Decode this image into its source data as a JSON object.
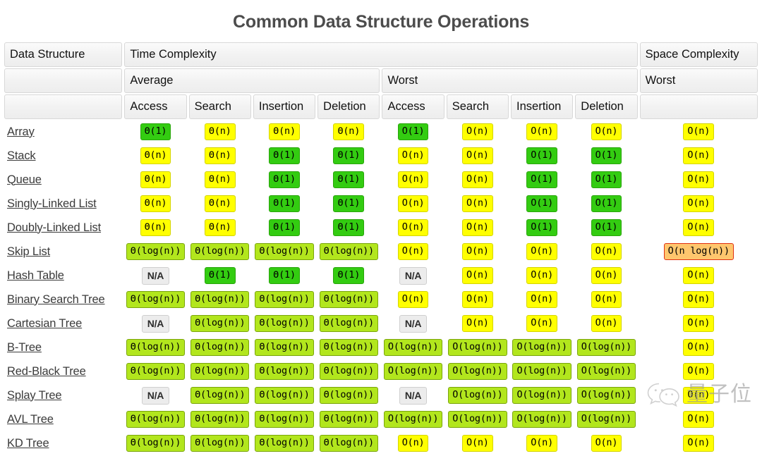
{
  "title": "Common Data Structure Operations",
  "colors": {
    "constant": "#33cc11",
    "logarithmic": "#b2e61d",
    "linear": "#ffff00",
    "linearithmic": "#ffc66d",
    "na": "#ececec",
    "title": "#4c4c4c"
  },
  "header": {
    "row1": {
      "data_structure": "Data Structure",
      "time_complexity": "Time Complexity",
      "space_complexity": "Space Complexity"
    },
    "row2": {
      "blank": "",
      "average": "Average",
      "worst": "Worst",
      "space_worst": "Worst"
    },
    "row3": {
      "blank": "",
      "avg_access": "Access",
      "avg_search": "Search",
      "avg_insertion": "Insertion",
      "avg_deletion": "Deletion",
      "worst_access": "Access",
      "worst_search": "Search",
      "worst_insertion": "Insertion",
      "worst_deletion": "Deletion",
      "space_blank": ""
    }
  },
  "chart_data": {
    "type": "table",
    "title": "Common Data Structure Operations",
    "columns": [
      "Data Structure",
      "Average Access",
      "Average Search",
      "Average Insertion",
      "Average Deletion",
      "Worst Access",
      "Worst Search",
      "Worst Insertion",
      "Worst Deletion",
      "Worst Space"
    ],
    "rows": [
      {
        "name": "Array",
        "cells": [
          {
            "t": "Θ(1)",
            "c": "green"
          },
          {
            "t": "Θ(n)",
            "c": "yellow"
          },
          {
            "t": "Θ(n)",
            "c": "yellow"
          },
          {
            "t": "Θ(n)",
            "c": "yellow"
          },
          {
            "t": "O(1)",
            "c": "green"
          },
          {
            "t": "O(n)",
            "c": "yellow"
          },
          {
            "t": "O(n)",
            "c": "yellow"
          },
          {
            "t": "O(n)",
            "c": "yellow"
          },
          {
            "t": "O(n)",
            "c": "yellow"
          }
        ]
      },
      {
        "name": "Stack",
        "cells": [
          {
            "t": "Θ(n)",
            "c": "yellow"
          },
          {
            "t": "Θ(n)",
            "c": "yellow"
          },
          {
            "t": "Θ(1)",
            "c": "green"
          },
          {
            "t": "Θ(1)",
            "c": "green"
          },
          {
            "t": "O(n)",
            "c": "yellow"
          },
          {
            "t": "O(n)",
            "c": "yellow"
          },
          {
            "t": "O(1)",
            "c": "green"
          },
          {
            "t": "O(1)",
            "c": "green"
          },
          {
            "t": "O(n)",
            "c": "yellow"
          }
        ]
      },
      {
        "name": "Queue",
        "cells": [
          {
            "t": "Θ(n)",
            "c": "yellow"
          },
          {
            "t": "Θ(n)",
            "c": "yellow"
          },
          {
            "t": "Θ(1)",
            "c": "green"
          },
          {
            "t": "Θ(1)",
            "c": "green"
          },
          {
            "t": "O(n)",
            "c": "yellow"
          },
          {
            "t": "O(n)",
            "c": "yellow"
          },
          {
            "t": "O(1)",
            "c": "green"
          },
          {
            "t": "O(1)",
            "c": "green"
          },
          {
            "t": "O(n)",
            "c": "yellow"
          }
        ]
      },
      {
        "name": "Singly-Linked List",
        "cells": [
          {
            "t": "Θ(n)",
            "c": "yellow"
          },
          {
            "t": "Θ(n)",
            "c": "yellow"
          },
          {
            "t": "Θ(1)",
            "c": "green"
          },
          {
            "t": "Θ(1)",
            "c": "green"
          },
          {
            "t": "O(n)",
            "c": "yellow"
          },
          {
            "t": "O(n)",
            "c": "yellow"
          },
          {
            "t": "O(1)",
            "c": "green"
          },
          {
            "t": "O(1)",
            "c": "green"
          },
          {
            "t": "O(n)",
            "c": "yellow"
          }
        ]
      },
      {
        "name": "Doubly-Linked List",
        "cells": [
          {
            "t": "Θ(n)",
            "c": "yellow"
          },
          {
            "t": "Θ(n)",
            "c": "yellow"
          },
          {
            "t": "Θ(1)",
            "c": "green"
          },
          {
            "t": "Θ(1)",
            "c": "green"
          },
          {
            "t": "O(n)",
            "c": "yellow"
          },
          {
            "t": "O(n)",
            "c": "yellow"
          },
          {
            "t": "O(1)",
            "c": "green"
          },
          {
            "t": "O(1)",
            "c": "green"
          },
          {
            "t": "O(n)",
            "c": "yellow"
          }
        ]
      },
      {
        "name": "Skip List",
        "cells": [
          {
            "t": "Θ(log(n))",
            "c": "lightgreen"
          },
          {
            "t": "Θ(log(n))",
            "c": "lightgreen"
          },
          {
            "t": "Θ(log(n))",
            "c": "lightgreen"
          },
          {
            "t": "Θ(log(n))",
            "c": "lightgreen"
          },
          {
            "t": "O(n)",
            "c": "yellow"
          },
          {
            "t": "O(n)",
            "c": "yellow"
          },
          {
            "t": "O(n)",
            "c": "yellow"
          },
          {
            "t": "O(n)",
            "c": "yellow"
          },
          {
            "t": "O(n log(n))",
            "c": "orange"
          }
        ]
      },
      {
        "name": "Hash Table",
        "cells": [
          {
            "t": "N/A",
            "c": "na"
          },
          {
            "t": "Θ(1)",
            "c": "green"
          },
          {
            "t": "Θ(1)",
            "c": "green"
          },
          {
            "t": "Θ(1)",
            "c": "green"
          },
          {
            "t": "N/A",
            "c": "na"
          },
          {
            "t": "O(n)",
            "c": "yellow"
          },
          {
            "t": "O(n)",
            "c": "yellow"
          },
          {
            "t": "O(n)",
            "c": "yellow"
          },
          {
            "t": "O(n)",
            "c": "yellow"
          }
        ]
      },
      {
        "name": "Binary Search Tree",
        "cells": [
          {
            "t": "Θ(log(n))",
            "c": "lightgreen"
          },
          {
            "t": "Θ(log(n))",
            "c": "lightgreen"
          },
          {
            "t": "Θ(log(n))",
            "c": "lightgreen"
          },
          {
            "t": "Θ(log(n))",
            "c": "lightgreen"
          },
          {
            "t": "O(n)",
            "c": "yellow"
          },
          {
            "t": "O(n)",
            "c": "yellow"
          },
          {
            "t": "O(n)",
            "c": "yellow"
          },
          {
            "t": "O(n)",
            "c": "yellow"
          },
          {
            "t": "O(n)",
            "c": "yellow"
          }
        ]
      },
      {
        "name": "Cartesian Tree",
        "cells": [
          {
            "t": "N/A",
            "c": "na"
          },
          {
            "t": "Θ(log(n))",
            "c": "lightgreen"
          },
          {
            "t": "Θ(log(n))",
            "c": "lightgreen"
          },
          {
            "t": "Θ(log(n))",
            "c": "lightgreen"
          },
          {
            "t": "N/A",
            "c": "na"
          },
          {
            "t": "O(n)",
            "c": "yellow"
          },
          {
            "t": "O(n)",
            "c": "yellow"
          },
          {
            "t": "O(n)",
            "c": "yellow"
          },
          {
            "t": "O(n)",
            "c": "yellow"
          }
        ]
      },
      {
        "name": "B-Tree",
        "cells": [
          {
            "t": "Θ(log(n))",
            "c": "lightgreen"
          },
          {
            "t": "Θ(log(n))",
            "c": "lightgreen"
          },
          {
            "t": "Θ(log(n))",
            "c": "lightgreen"
          },
          {
            "t": "Θ(log(n))",
            "c": "lightgreen"
          },
          {
            "t": "O(log(n))",
            "c": "lightgreen"
          },
          {
            "t": "O(log(n))",
            "c": "lightgreen"
          },
          {
            "t": "O(log(n))",
            "c": "lightgreen"
          },
          {
            "t": "O(log(n))",
            "c": "lightgreen"
          },
          {
            "t": "O(n)",
            "c": "yellow"
          }
        ]
      },
      {
        "name": "Red-Black Tree",
        "cells": [
          {
            "t": "Θ(log(n))",
            "c": "lightgreen"
          },
          {
            "t": "Θ(log(n))",
            "c": "lightgreen"
          },
          {
            "t": "Θ(log(n))",
            "c": "lightgreen"
          },
          {
            "t": "Θ(log(n))",
            "c": "lightgreen"
          },
          {
            "t": "O(log(n))",
            "c": "lightgreen"
          },
          {
            "t": "O(log(n))",
            "c": "lightgreen"
          },
          {
            "t": "O(log(n))",
            "c": "lightgreen"
          },
          {
            "t": "O(log(n))",
            "c": "lightgreen"
          },
          {
            "t": "O(n)",
            "c": "yellow"
          }
        ]
      },
      {
        "name": "Splay Tree",
        "cells": [
          {
            "t": "N/A",
            "c": "na"
          },
          {
            "t": "Θ(log(n))",
            "c": "lightgreen"
          },
          {
            "t": "Θ(log(n))",
            "c": "lightgreen"
          },
          {
            "t": "Θ(log(n))",
            "c": "lightgreen"
          },
          {
            "t": "N/A",
            "c": "na"
          },
          {
            "t": "O(log(n))",
            "c": "lightgreen"
          },
          {
            "t": "O(log(n))",
            "c": "lightgreen"
          },
          {
            "t": "O(log(n))",
            "c": "lightgreen"
          },
          {
            "t": "O(n)",
            "c": "yellow"
          }
        ]
      },
      {
        "name": "AVL Tree",
        "cells": [
          {
            "t": "Θ(log(n))",
            "c": "lightgreen"
          },
          {
            "t": "Θ(log(n))",
            "c": "lightgreen"
          },
          {
            "t": "Θ(log(n))",
            "c": "lightgreen"
          },
          {
            "t": "Θ(log(n))",
            "c": "lightgreen"
          },
          {
            "t": "O(log(n))",
            "c": "lightgreen"
          },
          {
            "t": "O(log(n))",
            "c": "lightgreen"
          },
          {
            "t": "O(log(n))",
            "c": "lightgreen"
          },
          {
            "t": "O(log(n))",
            "c": "lightgreen"
          },
          {
            "t": "O(n)",
            "c": "yellow"
          }
        ]
      },
      {
        "name": "KD Tree",
        "cells": [
          {
            "t": "Θ(log(n))",
            "c": "lightgreen"
          },
          {
            "t": "Θ(log(n))",
            "c": "lightgreen"
          },
          {
            "t": "Θ(log(n))",
            "c": "lightgreen"
          },
          {
            "t": "Θ(log(n))",
            "c": "lightgreen"
          },
          {
            "t": "O(n)",
            "c": "yellow"
          },
          {
            "t": "O(n)",
            "c": "yellow"
          },
          {
            "t": "O(n)",
            "c": "yellow"
          },
          {
            "t": "O(n)",
            "c": "yellow"
          },
          {
            "t": "O(n)",
            "c": "yellow"
          }
        ]
      }
    ]
  },
  "watermark": {
    "text": "量子位",
    "icon": "wechat-icon"
  }
}
